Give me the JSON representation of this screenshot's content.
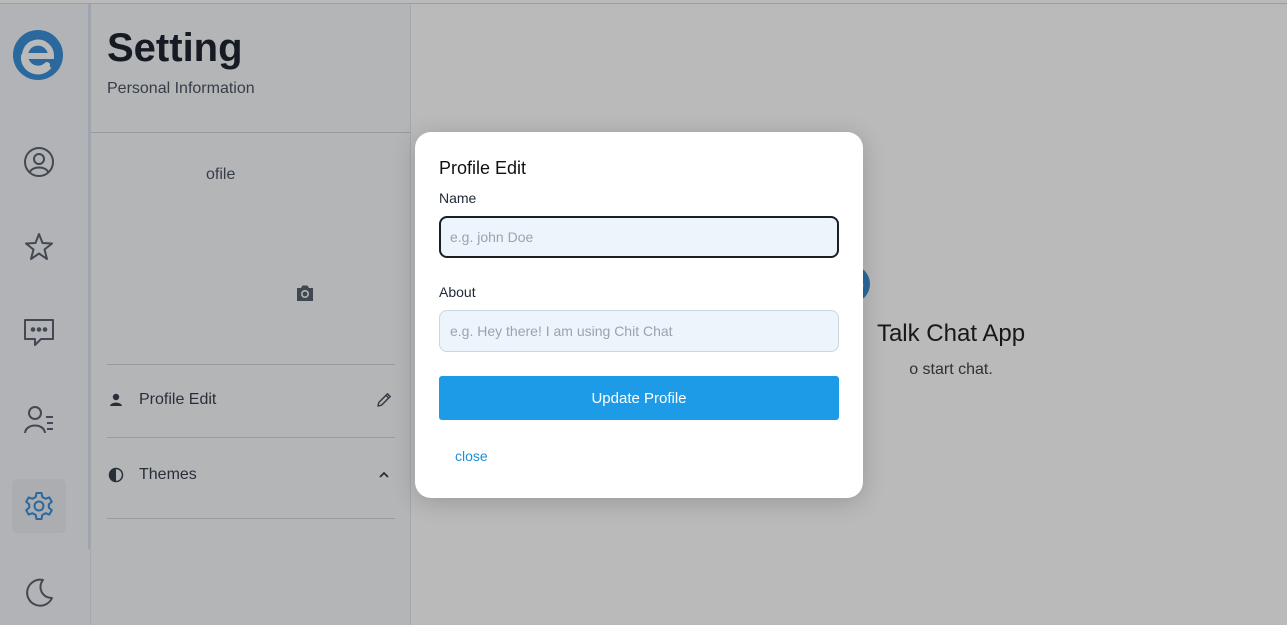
{
  "settings": {
    "title": "Setting",
    "subtitle": "Personal Information",
    "profile_label": "ofile",
    "items": [
      {
        "label": "Profile Edit",
        "icon": "person-icon",
        "end_icon": "pencil-icon"
      },
      {
        "label": "Themes",
        "icon": "half-circle-icon",
        "end_icon": "chevron-up-icon"
      }
    ]
  },
  "welcome": {
    "title": "Talk Chat App",
    "subtitle": "o start chat."
  },
  "modal": {
    "title": "Profile Edit",
    "name_label": "Name",
    "name_placeholder": "e.g. john Doe",
    "name_value": "",
    "about_label": "About",
    "about_placeholder": "e.g. Hey there! I am using Chit Chat",
    "about_value": "",
    "submit_label": "Update Profile",
    "close_label": "close"
  },
  "colors": {
    "accent": "#1d9be7",
    "brand_logo": "#3b8fd9",
    "overlay": "rgba(0,0,0,0.27)"
  },
  "sidebar_icons": [
    "user-circle-icon",
    "star-icon",
    "chat-bubble-icon",
    "contacts-icon",
    "gear-icon",
    "moon-icon"
  ]
}
